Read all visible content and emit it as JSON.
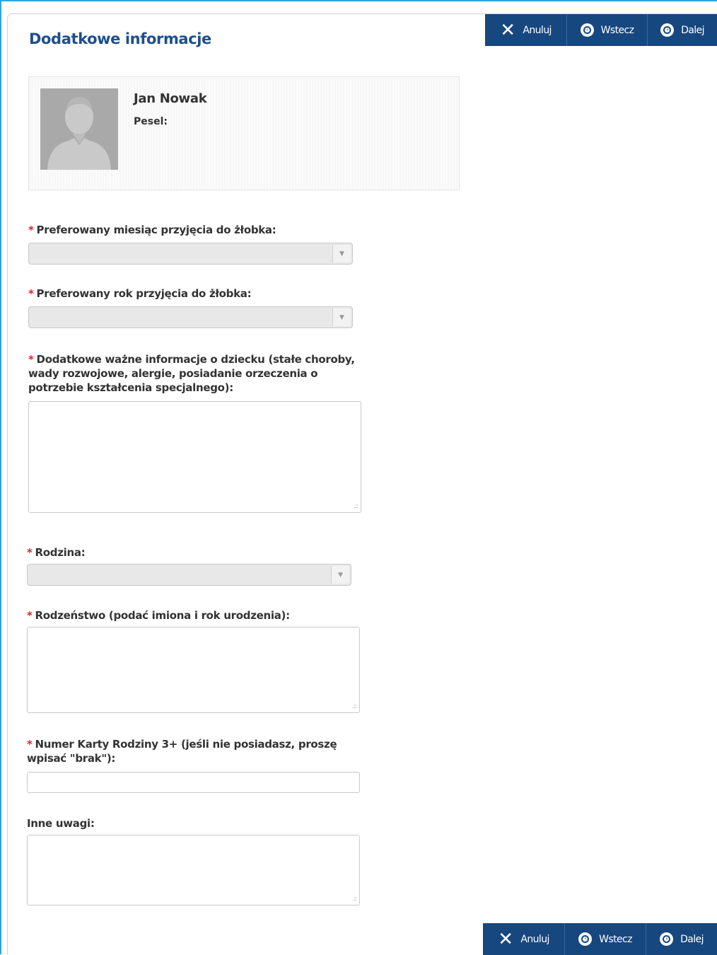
{
  "toolbar": {
    "cancel_label": "Anuluj",
    "back_label": "Wstecz",
    "next_label": "Dalej"
  },
  "page_title": "Dodatkowe informacje",
  "person": {
    "name": "Jan Nowak",
    "pesel_label": "Pesel:"
  },
  "required_marker": "*",
  "fields": {
    "month": {
      "label": "Preferowany miesiąc przyjęcia do żłobka:",
      "value": ""
    },
    "year": {
      "label": "Preferowany rok przyjęcia do żłobka:",
      "value": ""
    },
    "child_info": {
      "label": "Dodatkowe ważne informacje o dziecku (stałe choroby, wady rozwojowe, alergie, posiadanie orzeczenia o potrzebie kształcenia specjalnego):",
      "value": ""
    },
    "family": {
      "label": "Rodzina:",
      "value": ""
    },
    "siblings": {
      "label": "Rodzeństwo (podać imiona i rok urodzenia):",
      "value": ""
    },
    "family_card": {
      "label": "Numer Karty Rodziny 3+ (jeśli nie posiadasz, proszę wpisać \"brak\"):",
      "value": ""
    },
    "other_notes": {
      "label": "Inne uwagi:",
      "value": ""
    }
  },
  "colors": {
    "toolbar_bg": "#17477f",
    "title": "#1d4f8c",
    "required": "#d9262c",
    "frame_accent": "#29a8e0"
  },
  "icons": {
    "cancel": "x-icon",
    "back": "circle-arrow-left-icon",
    "next": "circle-arrow-right-icon",
    "select_arrow": "chevron-down-icon",
    "resize": "resize-grip-icon"
  }
}
